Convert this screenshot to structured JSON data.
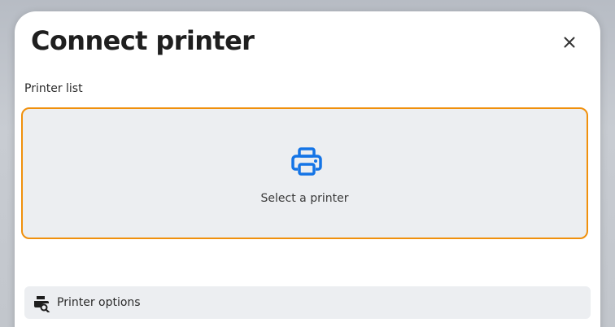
{
  "dialog": {
    "title": "Connect printer",
    "close_icon": "close-icon"
  },
  "printer_list": {
    "label": "Printer list",
    "placeholder": "Select a printer",
    "icon": "printer-icon",
    "border_color": "#f0900c",
    "icon_color": "#1474e6"
  },
  "printer_options": {
    "label": "Printer options",
    "icon": "printer-search-icon"
  }
}
